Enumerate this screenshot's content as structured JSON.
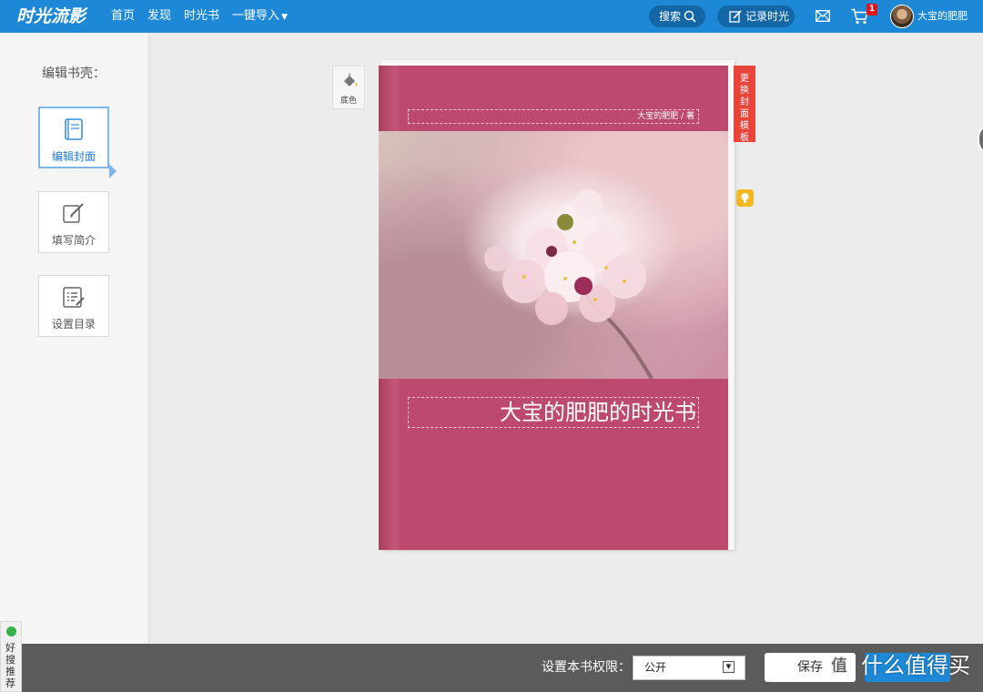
{
  "header": {
    "logo": "时光流影",
    "nav": [
      {
        "label": "首页"
      },
      {
        "label": "发现"
      },
      {
        "label": "时光书"
      },
      {
        "label": "一键导入",
        "dropdown": true
      }
    ],
    "search_label": "搜索",
    "record_label": "记录时光",
    "cart_count": "1",
    "username": "大宝的肥肥"
  },
  "sidebar": {
    "title": "编辑书壳：",
    "items": [
      {
        "label": "编辑封面",
        "icon": "book-icon",
        "active": true
      },
      {
        "label": "填写简介",
        "icon": "edit-pencil-icon",
        "active": false
      },
      {
        "label": "设置目录",
        "icon": "list-edit-icon",
        "active": false
      }
    ]
  },
  "editor": {
    "bgcolor_label": "底色",
    "author_line": "大宝的肥肥 / 著",
    "book_title": "大宝的肥肥的时光书",
    "change_template": [
      "更",
      "换",
      "封",
      "面",
      "模",
      "板"
    ],
    "colors": {
      "cover": "#bd4a6e",
      "accent": "#1d88d6",
      "template_tag": "#e8443a"
    }
  },
  "footer": {
    "permission_label": "设置本书权限：",
    "permission_value": "公开",
    "save_label": "保存",
    "watermark_glyph": "值",
    "watermark_text": "什么值得买"
  },
  "recommend": {
    "label": "好搜推荐"
  }
}
